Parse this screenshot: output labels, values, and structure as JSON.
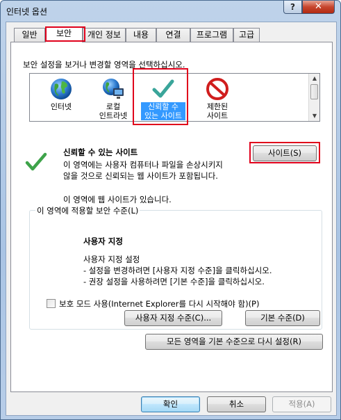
{
  "window": {
    "title": "인터넷 옵션",
    "help_label": "?",
    "close_label": "✕"
  },
  "tabs": [
    {
      "label": "일반"
    },
    {
      "label": "보안"
    },
    {
      "label": "개인 정보"
    },
    {
      "label": "내용"
    },
    {
      "label": "연결"
    },
    {
      "label": "프로그램"
    },
    {
      "label": "고급"
    }
  ],
  "security": {
    "instruction": "보안 설정을 보거나 변경할 영역을 선택하십시오.",
    "zones": [
      {
        "line1": "인터넷",
        "line2": "",
        "icon": "globe-icon"
      },
      {
        "line1": "로컬",
        "line2": "인트라넷",
        "icon": "intranet-icon"
      },
      {
        "line1": "신뢰할 수",
        "line2": "있는 사이트",
        "icon": "checkmark-icon"
      },
      {
        "line1": "제한된",
        "line2": "사이트",
        "icon": "restricted-icon"
      }
    ],
    "selected_zone": "신뢰할 수 있는 사이트",
    "zone_title": "신뢰할 수 있는 사이트",
    "zone_desc_line1": "이 영역에는 사용자 컴퓨터나 파일을 손상시키지",
    "zone_desc_line2": "않을 것으로 신뢰되는 웹 사이트가 포함됩니다.",
    "zone_status": "이 영역에 웹 사이트가 있습니다.",
    "sites_button": "사이트(S)",
    "level_group_title": "이 영역에 적용할 보안 수준(L)",
    "custom_title": "사용자 지정",
    "custom_line1": "사용자 지정 설정",
    "custom_line2": "- 설정을 변경하려면 [사용자 지정 수준]을 클릭하십시오.",
    "custom_line3": "- 권장 설정을 사용하려면 [기본 수준]을 클릭하십시오.",
    "protected_mode_label": "보호 모드 사용(Internet Explorer를 다시 시작해야 함)(P)",
    "protected_mode_checked": false,
    "custom_level_button": "사용자 지정 수준(C)...",
    "default_level_button": "기본 수준(D)",
    "reset_all_button": "모든 영역을 기본 수준으로 다시 설정(R)"
  },
  "footer": {
    "ok": "확인",
    "cancel": "취소",
    "apply": "적용(A)"
  },
  "colors": {
    "highlight_red": "#e0001b",
    "selection_blue": "#3399ff",
    "check_green": "#3ea34a"
  }
}
